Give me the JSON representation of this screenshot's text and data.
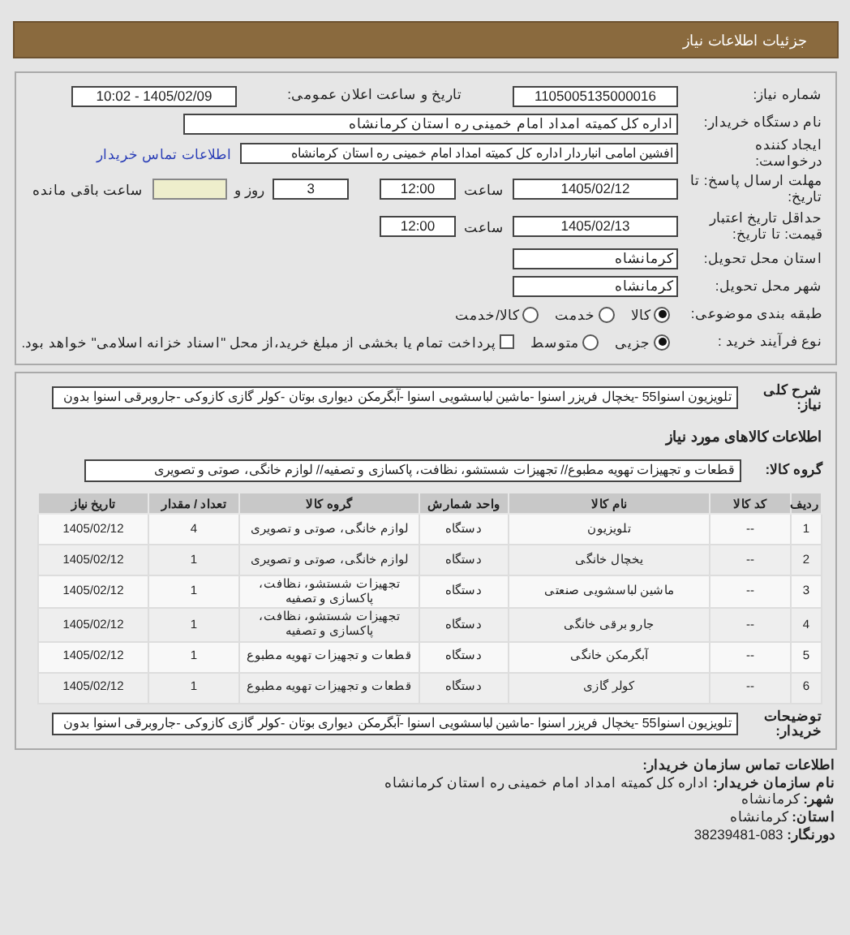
{
  "header": {
    "title": "جزئیات اطلاعات نیاز"
  },
  "form": {
    "need_number": {
      "label": "شماره نیاز:",
      "value": "1105005135000016"
    },
    "announce": {
      "label": "تاریخ و ساعت اعلان عمومی:",
      "value": "1405/02/09 - 10:02"
    },
    "buyer": {
      "label": "نام دستگاه خریدار:",
      "value": "اداره کل کمیته امداد امام خمینی  ره   استان کرمانشاه"
    },
    "requester": {
      "label": "ایجاد کننده درخواست:",
      "value": "افشین امامی انباردار اداره کل کمیته امداد امام خمینی  ره   استان کرمانشاه",
      "link": "اطلاعات تماس خریدار"
    },
    "deadline": {
      "label": "مهلت ارسال پاسخ: تا تاریخ:",
      "date": "1405/02/12",
      "time_label": "ساعت",
      "time": "12:00",
      "days": "3",
      "days_label": "روز و",
      "remaining_label": "ساعت باقی مانده"
    },
    "validity": {
      "label": "حداقل تاریخ اعتبار قیمت: تا تاریخ:",
      "date": "1405/02/13",
      "time_label": "ساعت",
      "time": "12:00"
    },
    "province": {
      "label": "استان محل تحویل:",
      "value": "کرمانشاه"
    },
    "city": {
      "label": "شهر محل تحویل:",
      "value": "کرمانشاه"
    },
    "category": {
      "label": "طبقه بندی موضوعی:",
      "options": [
        {
          "label": "کالا",
          "selected": true
        },
        {
          "label": "خدمت",
          "selected": false
        },
        {
          "label": "کالا/خدمت",
          "selected": false
        }
      ]
    },
    "process": {
      "label": "نوع فرآیند خرید :",
      "options": [
        {
          "label": "جزیی",
          "selected": true
        },
        {
          "label": "متوسط",
          "selected": false
        }
      ],
      "payment": {
        "label": "پرداخت تمام یا بخشی از مبلغ خرید،از محل \"اسناد خزانه اسلامی\" خواهد بود.",
        "checked": false
      }
    }
  },
  "summary": {
    "label": "شرح کلی نیاز:",
    "value": "تلویزیون اسنوا55 -یخچال فریزر اسنوا -ماشین لباسشویی اسنوا -آبگرمکن دیواری بوتان -کولر گازی کازوکی -جاروبرقی اسنوا بدون"
  },
  "goods_heading": "اطلاعات کالاهای مورد نیاز",
  "goods_group": {
    "label": "گروه کالا:",
    "value": "قطعات و تجهیزات تهویه مطبوع// تجهیزات شستشو، نظافت، پاکسازی و تصفیه// لوازم خانگی، صوتی و تصویری"
  },
  "table": {
    "columns": [
      "ردیف",
      "کد کالا",
      "نام کالا",
      "واحد شمارش",
      "گروه کالا",
      "تعداد / مقدار",
      "تاریخ نیاز"
    ],
    "rows": [
      [
        "1",
        "--",
        "تلویزیون",
        "دستگاه",
        "لوازم خانگی، صوتی و تصویری",
        "4",
        "1405/02/12"
      ],
      [
        "2",
        "--",
        "یخچال خانگی",
        "دستگاه",
        "لوازم خانگی، صوتی و تصویری",
        "1",
        "1405/02/12"
      ],
      [
        "3",
        "--",
        "ماشین لباسشویی صنعتی",
        "دستگاه",
        "تجهیزات شستشو، نظافت، پاکسازی و تصفیه",
        "1",
        "1405/02/12"
      ],
      [
        "4",
        "--",
        "جارو برقی خانگی",
        "دستگاه",
        "تجهیزات شستشو، نظافت، پاکسازی و تصفیه",
        "1",
        "1405/02/12"
      ],
      [
        "5",
        "--",
        "آبگرمکن خانگی",
        "دستگاه",
        "قطعات و تجهیزات تهویه مطبوع",
        "1",
        "1405/02/12"
      ],
      [
        "6",
        "--",
        "کولر گازی",
        "دستگاه",
        "قطعات و تجهیزات تهویه مطبوع",
        "1",
        "1405/02/12"
      ]
    ]
  },
  "buyer_notes": {
    "label": "توضیحات خریدار:",
    "value": "تلویزیون اسنوا55 -یخچال فریزر اسنوا -ماشین لباسشویی اسنوا -آبگرمکن دیواری بوتان -کولر گازی کازوکی -جاروبرقی اسنوا بدون"
  },
  "contact": {
    "title": "اطلاعات تماس سازمان خریدار:",
    "lines": [
      {
        "label": "نام سازمان خریدار:",
        "value": "اداره کل کمیته امداد امام خمینی ره استان کرمانشاه"
      },
      {
        "label": "شهر:",
        "value": "کرمانشاه"
      },
      {
        "label": "استان:",
        "value": "کرمانشاه"
      },
      {
        "label": "دورنگار:",
        "value": "083-38239481"
      }
    ]
  }
}
